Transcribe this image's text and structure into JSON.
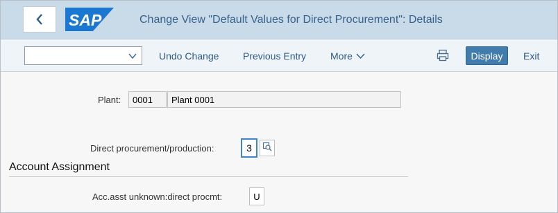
{
  "header": {
    "title": "Change View \"Default Values for Direct Procurement\": Details",
    "logo_text": "SAP",
    "brand_color": "#0a6ed1",
    "icons": {
      "back": "chevron-left-icon",
      "logo": "sap-logo"
    }
  },
  "toolbar": {
    "command_field": {
      "value": "",
      "placeholder": ""
    },
    "undo_label": "Undo Change",
    "previous_label": "Previous Entry",
    "more_label": "More",
    "display_label": "Display",
    "exit_label": "Exit",
    "icons": {
      "dropdown": "chevron-down-icon",
      "more": "chevron-down-icon",
      "print": "print-icon"
    }
  },
  "form": {
    "plant_label": "Plant:",
    "plant_code": "0001",
    "plant_name": "Plant 0001",
    "direct_proc_label": "Direct procurement/production:",
    "direct_proc_value": "3",
    "section_title": "Account Assignment",
    "acc_label": "Acc.asst unknown:direct procmt:",
    "acc_value": "U",
    "icons": {
      "value_help": "value-help-icon"
    }
  }
}
